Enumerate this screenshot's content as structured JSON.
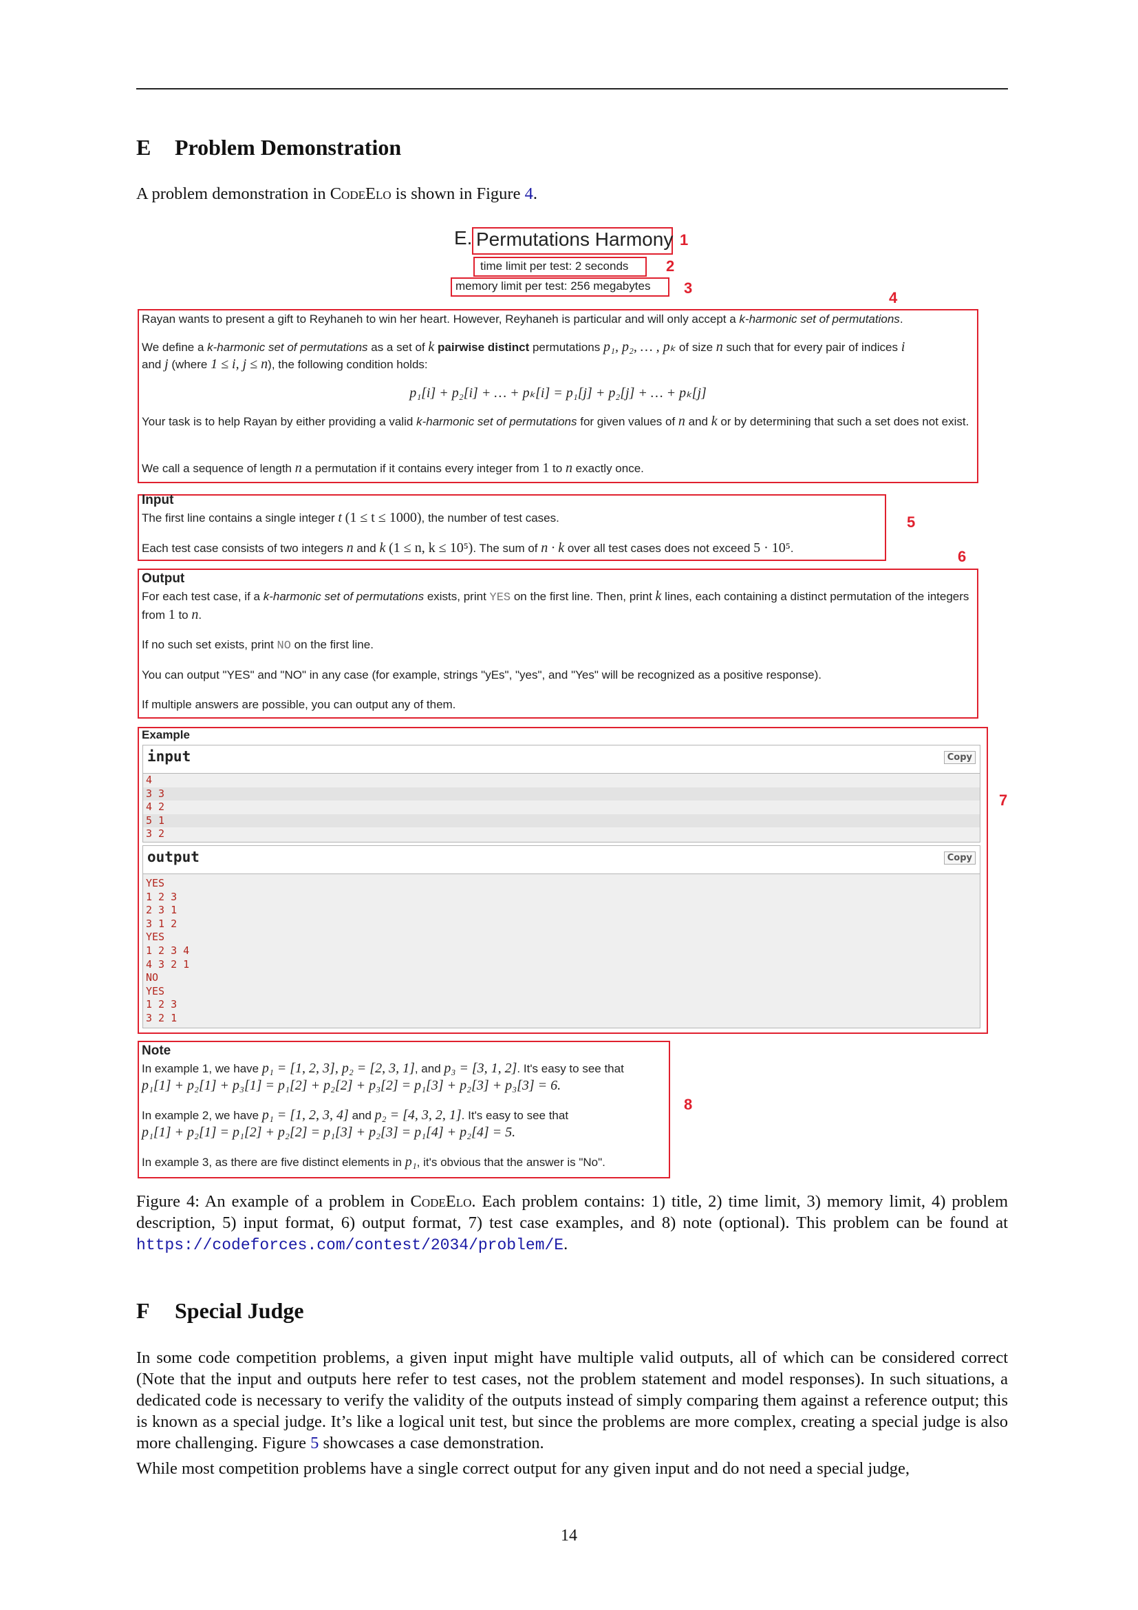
{
  "section_e": {
    "num": "E",
    "title": "Problem Demonstration",
    "intro_before": "A problem demonstration in ",
    "intro_name": "CodeElo",
    "intro_mid": " is shown in Figure ",
    "intro_ref": "4",
    "intro_end": "."
  },
  "figure": {
    "prefix": "E. ",
    "title": "Permutations Harmony",
    "time_limit": "time limit per test: 2 seconds",
    "memory_limit": "memory limit per test: 256 megabytes",
    "labels": [
      "1",
      "2",
      "3",
      "4",
      "5",
      "6",
      "7",
      "8"
    ],
    "statement": {
      "p1_a": "Rayan wants to present a gift to Reyhaneh to win her heart. However, Reyhaneh is particular and will only accept a ",
      "p1_em": "k-harmonic set of permutations",
      "p1_b": ".",
      "p2_a": "We define a ",
      "p2_em": "k-harmonic set of permutations",
      "p2_b": " as a set of ",
      "p2_k": "k",
      "p2_bold": "pairwise distinct",
      "p2_c": " permutations ",
      "p2_perms": "p₁, p₂, … , pₖ",
      "p2_d": " of size ",
      "p2_n": "n",
      "p2_e": " such that for every pair of indices ",
      "p2_i": "i",
      "p2_f": " and ",
      "p2_j": "j",
      "p2_g": " (where ",
      "p2_range": "1 ≤ i, j ≤ n",
      "p2_h": "), the following condition holds:",
      "equation": "p₁[i] + p₂[i] + … + pₖ[i] = p₁[j] + p₂[j] + … + pₖ[j]",
      "p3_a": "Your task is to help Rayan by either providing a valid ",
      "p3_em": "k-harmonic set of permutations",
      "p3_b": " for given values of ",
      "p3_n": "n",
      "p3_c": " and ",
      "p3_k": "k",
      "p3_d": " or by determining that such a set does not exist.",
      "p4_a": "We call a sequence of length ",
      "p4_n": "n",
      "p4_b": " a permutation if it contains every integer from ",
      "p4_one": "1",
      "p4_c": " to ",
      "p4_n2": "n",
      "p4_d": " exactly once."
    },
    "input_section": {
      "header": "Input",
      "l1_a": "The first line contains a single integer ",
      "l1_t": "t",
      "l1_range": "(1 ≤ t ≤ 1000)",
      "l1_b": ", the number of test cases.",
      "l2_a": "Each test case consists of two integers ",
      "l2_n": "n",
      "l2_b": " and ",
      "l2_k": "k",
      "l2_range": "(1 ≤ n, k ≤ 10⁵)",
      "l2_c": ". The sum of ",
      "l2_nk": "n · k",
      "l2_d": " over all test cases does not exceed ",
      "l2_max": "5 · 10⁵",
      "l2_e": "."
    },
    "output_section": {
      "header": "Output",
      "l1_a": "For each test case, if a ",
      "l1_em": "k-harmonic set of permutations",
      "l1_b": " exists, print ",
      "l1_yes": "YES",
      "l1_c": " on the first line. Then, print ",
      "l1_k": "k",
      "l1_d": " lines, each containing a distinct permutation of the integers from ",
      "l1_one": "1",
      "l1_e": " to ",
      "l1_n": "n",
      "l1_f": ".",
      "l2_a": "If no such set exists, print ",
      "l2_no": "NO",
      "l2_b": " on the first line.",
      "l3": "You can output \"YES\" and \"NO\" in any case (for example, strings \"yEs\", \"yes\", and \"Yes\" will be recognized as a positive response).",
      "l4": "If multiple answers are possible, you can output any of them."
    },
    "example": {
      "header": "Example",
      "input_title": "input",
      "output_title": "output",
      "copy_label": "Copy",
      "input_lines": [
        "4",
        "3 3",
        "4 2",
        "5 1",
        "3 2"
      ],
      "output_lines": [
        "YES",
        "1 2 3",
        "2 3 1",
        "3 1 2",
        "YES",
        "1 2 3 4",
        "4 3 2 1",
        "NO",
        "YES",
        "1 2 3",
        "3 2 1"
      ]
    },
    "note": {
      "header": "Note",
      "e1_a": "In example 1, we have ",
      "e1_math": "p₁ = [1, 2, 3], p₂ = [2, 3, 1]",
      "e1_b": ", and ",
      "e1_p3": "p₃ = [3, 1, 2]",
      "e1_c": ". It's easy to see that",
      "e1_eq": "p₁[1] + p₂[1] + p₃[1] = p₁[2] + p₂[2] + p₃[2] = p₁[3] + p₂[3] + p₃[3] = 6.",
      "e2_a": "In example 2, we have ",
      "e2_p1": "p₁ = [1, 2, 3, 4]",
      "e2_b": " and ",
      "e2_p2": "p₂ = [4, 3, 2, 1]",
      "e2_c": ". It's easy to see that",
      "e2_eq": "p₁[1] + p₂[1] = p₁[2] + p₂[2] = p₁[3] + p₂[3] = p₁[4] + p₂[4] = 5.",
      "e3_a": "In example 3, as there are five distinct elements in ",
      "e3_p1": "p₁",
      "e3_b": ", it's obvious that the answer is \"No\"."
    }
  },
  "caption": {
    "lead": "Figure 4:  An example of a problem in ",
    "name": "CodeElo",
    "text": ". Each problem contains: 1) title, 2) time limit, 3) memory limit, 4) problem description, 5) input format, 6) output format, 7) test case examples, and 8) note (optional). This problem can be found at ",
    "url": "https://codeforces.com/contest/2034/problem/E",
    "end": "."
  },
  "section_f": {
    "num": "F",
    "title": "Special Judge",
    "p1_a": "In some code competition problems, a given input might have multiple valid outputs, all of which can be considered correct (Note that the input and outputs here refer to test cases, not the problem statement and model responses). In such situations, a dedicated code is necessary to verify the validity of the outputs instead of simply comparing them against a reference output; this is known as a special judge. It’s like a logical unit test, but since the problems are more complex, creating a special judge is also more challenging. Figure ",
    "p1_ref": "5",
    "p1_b": " showcases a case demonstration.",
    "p2": "While most competition problems have a single correct output for any given input and do not need a special judge,"
  },
  "page_number": "14"
}
